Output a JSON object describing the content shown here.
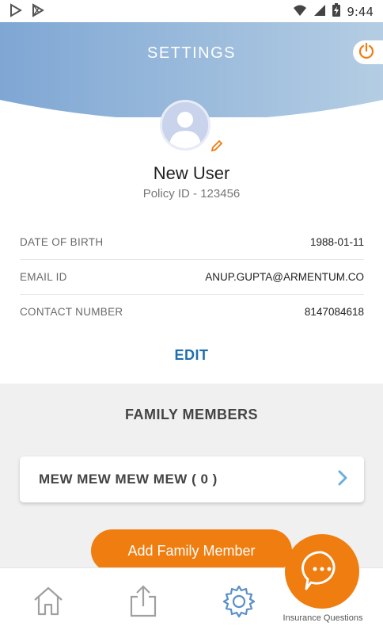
{
  "status_bar": {
    "time": "9:44",
    "icons": [
      "play-store-outline-icon",
      "play-store-icon",
      "wifi-icon",
      "cellular-signal-icon",
      "battery-charging-icon"
    ]
  },
  "header": {
    "title": "SETTINGS",
    "power_icon": "power-icon"
  },
  "colors": {
    "header_blue": "#9bbbdb",
    "accent_orange": "#ef7d10",
    "link_blue": "#1f6fb0",
    "nav_active": "#5b8fc8"
  },
  "profile": {
    "name": "New User",
    "policy_id": "Policy ID - 123456",
    "rows": [
      {
        "label": "DATE OF BIRTH",
        "value": "1988-01-11"
      },
      {
        "label": "EMAIL ID",
        "value": "ANUP.GUPTA@ARMENTUM.CO"
      },
      {
        "label": "CONTACT NUMBER",
        "value": "8147084618"
      }
    ],
    "edit_label": "EDIT"
  },
  "family": {
    "title": "FAMILY MEMBERS",
    "members": [
      {
        "name": "MEW MEW MEW MEW ( 0 )"
      }
    ],
    "add_label": "Add Family Member"
  },
  "bottom_nav": {
    "items": [
      {
        "icon": "home-icon",
        "active": false
      },
      {
        "icon": "share-icon",
        "active": false
      },
      {
        "icon": "gear-icon",
        "active": true
      }
    ]
  },
  "chat": {
    "label": "Insurance Questions"
  }
}
